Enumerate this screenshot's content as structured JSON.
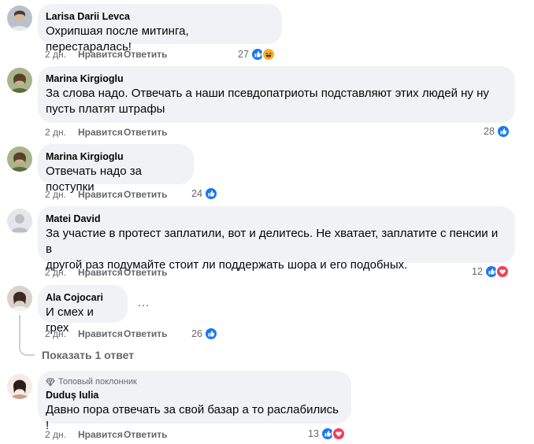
{
  "action_labels": {
    "like": "Нравится",
    "reply": "Ответить"
  },
  "comments": [
    {
      "author": "Larisa Darii Levca",
      "text": "Охрипшая после митинга, перестаралась!",
      "time": "2 дн.",
      "reactions_count": "27",
      "reactions": [
        "like-icon",
        "haha-icon"
      ]
    },
    {
      "author": "Marina Kirgioglu",
      "text_lines": [
        "За слова надо. Отвечать а наши псевдопатриоты подставляют этих людей ну ну",
        "пусть платят штрафы"
      ],
      "time": "2 дн.",
      "reactions_count": "28",
      "reactions": [
        "like-icon"
      ]
    },
    {
      "author": "Marina Kirgioglu",
      "text": "Отвечать надо за поступки",
      "time": "2 дн.",
      "reactions_count": "24",
      "reactions": [
        "like-icon"
      ]
    },
    {
      "author": "Matei David",
      "text_lines": [
        "За участие в протест заплатили, вот и делитесь. Не хватает, заплатите с пенсии и в",
        "другой раз подумайте стоит ли поддержать шора и его подобных."
      ],
      "time": "2 дн.",
      "reactions_count": "12",
      "reactions": [
        "like-icon",
        "love-icon"
      ]
    },
    {
      "author": "Ala Cojocari",
      "text": "И смех и грех",
      "time": "2 дн.",
      "reactions_count": "26",
      "reactions": [
        "like-icon"
      ],
      "more": "…",
      "show_replies": "Показать 1 ответ"
    },
    {
      "badge": "Топовый поклонник",
      "author": "Duduș Iulia",
      "text": "Давно пора отвечать за свой базар а то раслабились !",
      "time": "2 дн.",
      "reactions_count": "13",
      "reactions": [
        "like-icon",
        "love-icon"
      ]
    }
  ],
  "colors": {
    "like": "#1877f2",
    "love": "#f33e58",
    "haha": "#f7b125",
    "bubble": "#f0f2f5",
    "secondary_text": "#65676b"
  }
}
